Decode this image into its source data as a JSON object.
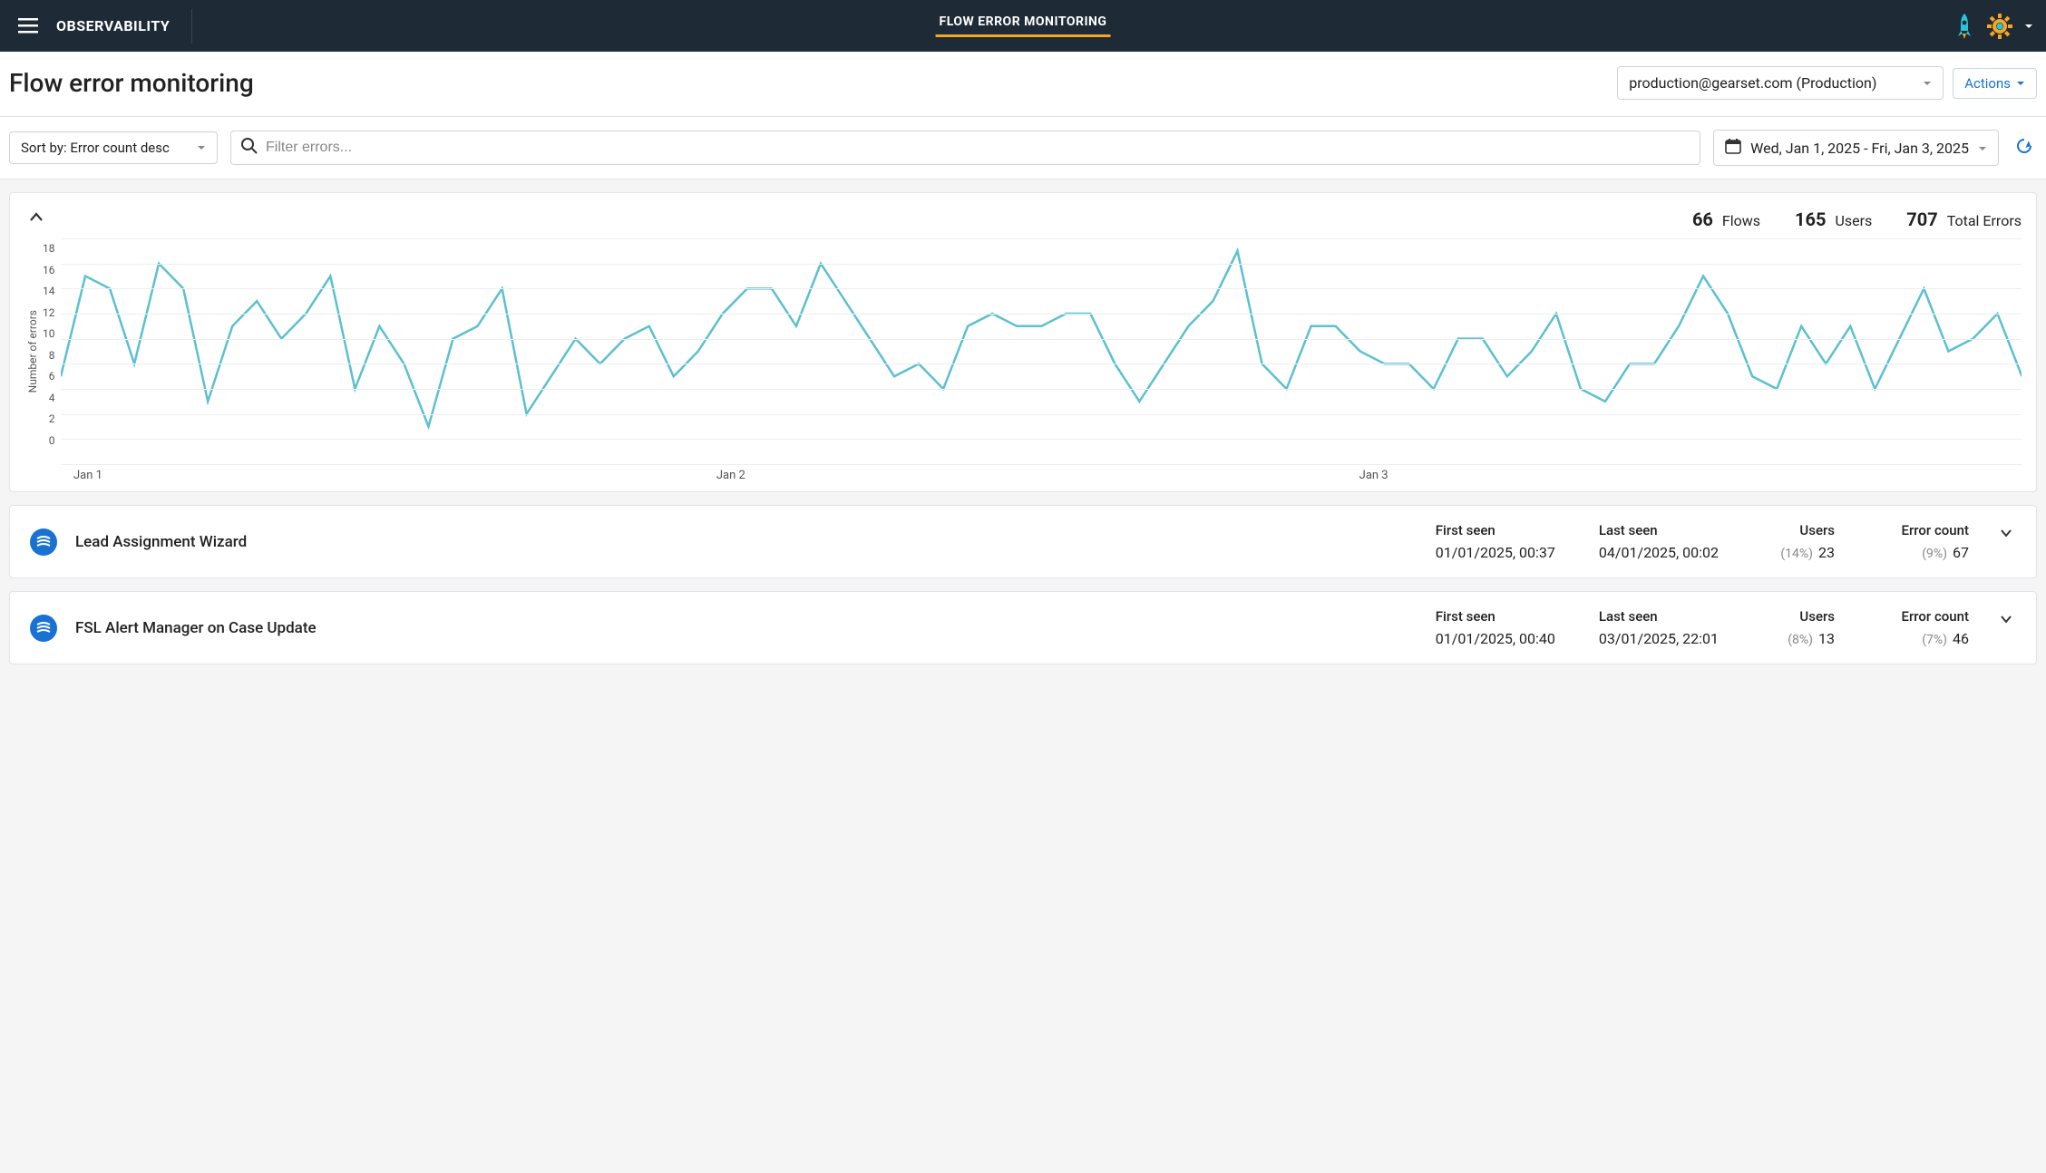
{
  "header": {
    "brand": "OBSERVABILITY",
    "top_tab": "FLOW ERROR MONITORING"
  },
  "page": {
    "title": "Flow error monitoring",
    "org_selected": "production@gearset.com (Production)",
    "actions_label": "Actions"
  },
  "filters": {
    "sort_label": "Sort by: Error count desc",
    "search_placeholder": "Filter errors...",
    "date_range": "Wed, Jan 1, 2025 - Fri, Jan 3, 2025"
  },
  "summary": {
    "flows_value": "66",
    "flows_label": "Flows",
    "users_value": "165",
    "users_label": "Users",
    "errors_value": "707",
    "errors_label": "Total Errors"
  },
  "chart_data": {
    "type": "line",
    "ylabel": "Number of errors",
    "ylim": [
      0,
      18
    ],
    "y_ticks": [
      "18",
      "16",
      "14",
      "12",
      "10",
      "8",
      "6",
      "4",
      "2",
      "0"
    ],
    "x_labels": [
      "Jan 1",
      "Jan 2",
      "Jan 3"
    ],
    "categories": [
      "Jan 1",
      "Jan 2",
      "Jan 3"
    ],
    "values": [
      7,
      15,
      14,
      8,
      16,
      14,
      5,
      11,
      13,
      10,
      12,
      15,
      6,
      11,
      8,
      3,
      10,
      11,
      14,
      4,
      7,
      10,
      8,
      10,
      11,
      7,
      9,
      12,
      14,
      14,
      11,
      16,
      13,
      10,
      7,
      8,
      6,
      11,
      12,
      11,
      11,
      12,
      12,
      8,
      5,
      8,
      11,
      13,
      17,
      8,
      6,
      11,
      11,
      9,
      8,
      8,
      6,
      10,
      10,
      7,
      9,
      12,
      6,
      5,
      8,
      8,
      11,
      15,
      12,
      7,
      6,
      11,
      8,
      11,
      6,
      10,
      14,
      9,
      10,
      12,
      7
    ]
  },
  "columns": {
    "first_seen": "First seen",
    "last_seen": "Last seen",
    "users": "Users",
    "error_count": "Error count"
  },
  "flows": [
    {
      "name": "Lead Assignment Wizard",
      "first_seen": "01/01/2025, 00:37",
      "last_seen": "04/01/2025, 00:02",
      "users_pct": "(14%)",
      "users": "23",
      "errors_pct": "(9%)",
      "errors": "67"
    },
    {
      "name": "FSL Alert Manager on Case Update",
      "first_seen": "01/01/2025, 00:40",
      "last_seen": "03/01/2025, 22:01",
      "users_pct": "(8%)",
      "users": "13",
      "errors_pct": "(7%)",
      "errors": "46"
    }
  ]
}
